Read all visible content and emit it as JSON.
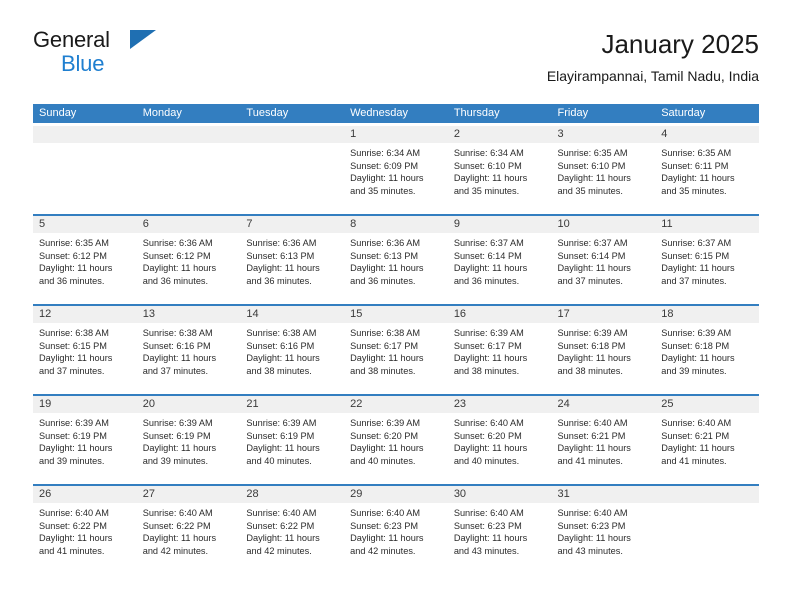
{
  "brand": {
    "line1": "General",
    "line2": "Blue",
    "triangle_color": "#1f6fb2",
    "blue_color": "#1f7fd0"
  },
  "header": {
    "title": "January 2025",
    "subtitle": "Elayirampannai, Tamil Nadu, India"
  },
  "colors": {
    "header_blue": "#337ec0",
    "day_band_gray": "#f0f0f0",
    "text": "#2b2b2b"
  },
  "weekdays": [
    "Sunday",
    "Monday",
    "Tuesday",
    "Wednesday",
    "Thursday",
    "Friday",
    "Saturday"
  ],
  "chart_data": {
    "type": "table",
    "title": "January 2025",
    "subtitle": "Elayirampannai, Tamil Nadu, India",
    "columns": [
      "Sunday",
      "Monday",
      "Tuesday",
      "Wednesday",
      "Thursday",
      "Friday",
      "Saturday"
    ],
    "rows": 5
  },
  "weeks": [
    [
      {
        "day": "",
        "empty": true
      },
      {
        "day": "",
        "empty": true
      },
      {
        "day": "",
        "empty": true
      },
      {
        "day": "1",
        "sunrise": "Sunrise: 6:34 AM",
        "sunset": "Sunset: 6:09 PM",
        "daylight1": "Daylight: 11 hours",
        "daylight2": "and 35 minutes."
      },
      {
        "day": "2",
        "sunrise": "Sunrise: 6:34 AM",
        "sunset": "Sunset: 6:10 PM",
        "daylight1": "Daylight: 11 hours",
        "daylight2": "and 35 minutes."
      },
      {
        "day": "3",
        "sunrise": "Sunrise: 6:35 AM",
        "sunset": "Sunset: 6:10 PM",
        "daylight1": "Daylight: 11 hours",
        "daylight2": "and 35 minutes."
      },
      {
        "day": "4",
        "sunrise": "Sunrise: 6:35 AM",
        "sunset": "Sunset: 6:11 PM",
        "daylight1": "Daylight: 11 hours",
        "daylight2": "and 35 minutes."
      }
    ],
    [
      {
        "day": "5",
        "sunrise": "Sunrise: 6:35 AM",
        "sunset": "Sunset: 6:12 PM",
        "daylight1": "Daylight: 11 hours",
        "daylight2": "and 36 minutes."
      },
      {
        "day": "6",
        "sunrise": "Sunrise: 6:36 AM",
        "sunset": "Sunset: 6:12 PM",
        "daylight1": "Daylight: 11 hours",
        "daylight2": "and 36 minutes."
      },
      {
        "day": "7",
        "sunrise": "Sunrise: 6:36 AM",
        "sunset": "Sunset: 6:13 PM",
        "daylight1": "Daylight: 11 hours",
        "daylight2": "and 36 minutes."
      },
      {
        "day": "8",
        "sunrise": "Sunrise: 6:36 AM",
        "sunset": "Sunset: 6:13 PM",
        "daylight1": "Daylight: 11 hours",
        "daylight2": "and 36 minutes."
      },
      {
        "day": "9",
        "sunrise": "Sunrise: 6:37 AM",
        "sunset": "Sunset: 6:14 PM",
        "daylight1": "Daylight: 11 hours",
        "daylight2": "and 36 minutes."
      },
      {
        "day": "10",
        "sunrise": "Sunrise: 6:37 AM",
        "sunset": "Sunset: 6:14 PM",
        "daylight1": "Daylight: 11 hours",
        "daylight2": "and 37 minutes."
      },
      {
        "day": "11",
        "sunrise": "Sunrise: 6:37 AM",
        "sunset": "Sunset: 6:15 PM",
        "daylight1": "Daylight: 11 hours",
        "daylight2": "and 37 minutes."
      }
    ],
    [
      {
        "day": "12",
        "sunrise": "Sunrise: 6:38 AM",
        "sunset": "Sunset: 6:15 PM",
        "daylight1": "Daylight: 11 hours",
        "daylight2": "and 37 minutes."
      },
      {
        "day": "13",
        "sunrise": "Sunrise: 6:38 AM",
        "sunset": "Sunset: 6:16 PM",
        "daylight1": "Daylight: 11 hours",
        "daylight2": "and 37 minutes."
      },
      {
        "day": "14",
        "sunrise": "Sunrise: 6:38 AM",
        "sunset": "Sunset: 6:16 PM",
        "daylight1": "Daylight: 11 hours",
        "daylight2": "and 38 minutes."
      },
      {
        "day": "15",
        "sunrise": "Sunrise: 6:38 AM",
        "sunset": "Sunset: 6:17 PM",
        "daylight1": "Daylight: 11 hours",
        "daylight2": "and 38 minutes."
      },
      {
        "day": "16",
        "sunrise": "Sunrise: 6:39 AM",
        "sunset": "Sunset: 6:17 PM",
        "daylight1": "Daylight: 11 hours",
        "daylight2": "and 38 minutes."
      },
      {
        "day": "17",
        "sunrise": "Sunrise: 6:39 AM",
        "sunset": "Sunset: 6:18 PM",
        "daylight1": "Daylight: 11 hours",
        "daylight2": "and 38 minutes."
      },
      {
        "day": "18",
        "sunrise": "Sunrise: 6:39 AM",
        "sunset": "Sunset: 6:18 PM",
        "daylight1": "Daylight: 11 hours",
        "daylight2": "and 39 minutes."
      }
    ],
    [
      {
        "day": "19",
        "sunrise": "Sunrise: 6:39 AM",
        "sunset": "Sunset: 6:19 PM",
        "daylight1": "Daylight: 11 hours",
        "daylight2": "and 39 minutes."
      },
      {
        "day": "20",
        "sunrise": "Sunrise: 6:39 AM",
        "sunset": "Sunset: 6:19 PM",
        "daylight1": "Daylight: 11 hours",
        "daylight2": "and 39 minutes."
      },
      {
        "day": "21",
        "sunrise": "Sunrise: 6:39 AM",
        "sunset": "Sunset: 6:19 PM",
        "daylight1": "Daylight: 11 hours",
        "daylight2": "and 40 minutes."
      },
      {
        "day": "22",
        "sunrise": "Sunrise: 6:39 AM",
        "sunset": "Sunset: 6:20 PM",
        "daylight1": "Daylight: 11 hours",
        "daylight2": "and 40 minutes."
      },
      {
        "day": "23",
        "sunrise": "Sunrise: 6:40 AM",
        "sunset": "Sunset: 6:20 PM",
        "daylight1": "Daylight: 11 hours",
        "daylight2": "and 40 minutes."
      },
      {
        "day": "24",
        "sunrise": "Sunrise: 6:40 AM",
        "sunset": "Sunset: 6:21 PM",
        "daylight1": "Daylight: 11 hours",
        "daylight2": "and 41 minutes."
      },
      {
        "day": "25",
        "sunrise": "Sunrise: 6:40 AM",
        "sunset": "Sunset: 6:21 PM",
        "daylight1": "Daylight: 11 hours",
        "daylight2": "and 41 minutes."
      }
    ],
    [
      {
        "day": "26",
        "sunrise": "Sunrise: 6:40 AM",
        "sunset": "Sunset: 6:22 PM",
        "daylight1": "Daylight: 11 hours",
        "daylight2": "and 41 minutes."
      },
      {
        "day": "27",
        "sunrise": "Sunrise: 6:40 AM",
        "sunset": "Sunset: 6:22 PM",
        "daylight1": "Daylight: 11 hours",
        "daylight2": "and 42 minutes."
      },
      {
        "day": "28",
        "sunrise": "Sunrise: 6:40 AM",
        "sunset": "Sunset: 6:22 PM",
        "daylight1": "Daylight: 11 hours",
        "daylight2": "and 42 minutes."
      },
      {
        "day": "29",
        "sunrise": "Sunrise: 6:40 AM",
        "sunset": "Sunset: 6:23 PM",
        "daylight1": "Daylight: 11 hours",
        "daylight2": "and 42 minutes."
      },
      {
        "day": "30",
        "sunrise": "Sunrise: 6:40 AM",
        "sunset": "Sunset: 6:23 PM",
        "daylight1": "Daylight: 11 hours",
        "daylight2": "and 43 minutes."
      },
      {
        "day": "31",
        "sunrise": "Sunrise: 6:40 AM",
        "sunset": "Sunset: 6:23 PM",
        "daylight1": "Daylight: 11 hours",
        "daylight2": "and 43 minutes."
      },
      {
        "day": "",
        "empty": true
      }
    ]
  ]
}
